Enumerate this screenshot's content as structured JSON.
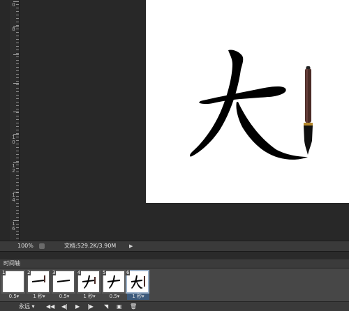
{
  "ruler": {
    "labels": [
      "0",
      "8",
      "1\n0",
      "1\n2",
      "1\n4",
      "1\n6"
    ]
  },
  "statusbar": {
    "zoom": "100%",
    "doc_info": "文档:529.2K/3.90M",
    "arrow": "▶"
  },
  "timeline": {
    "panel_title": "时间轴",
    "frames": [
      {
        "number": "1",
        "delay": "0.5▾"
      },
      {
        "number": "2",
        "delay": "1 秒▾"
      },
      {
        "number": "3",
        "delay": "0.5▾"
      },
      {
        "number": "4",
        "delay": "1 秒▾"
      },
      {
        "number": "5",
        "delay": "0.5▾"
      },
      {
        "number": "6",
        "delay": "1 秒▾"
      }
    ],
    "controls": {
      "loop": "永远 ▾",
      "first": "◀◀",
      "prev": "◀|",
      "play": "▶",
      "next": "|▶",
      "tween": "◥",
      "new_frame": "▣",
      "delete": "🗑"
    }
  },
  "colors": {
    "selection": "#3c5a7c",
    "canvas": "#ffffff",
    "workspace": "#282828"
  }
}
